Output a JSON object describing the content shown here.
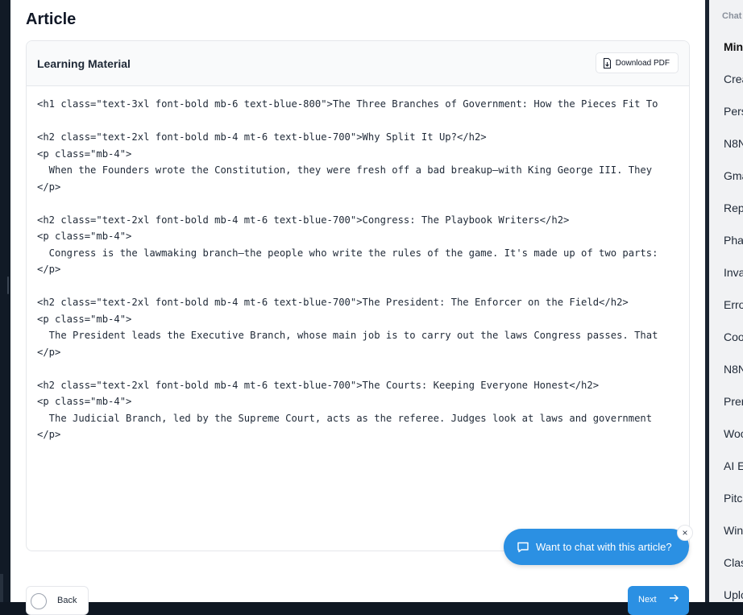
{
  "page": {
    "title": "Article"
  },
  "card": {
    "title": "Learning Material",
    "download_label": "Download PDF",
    "code_lines": [
      "<h1 class=\"text-3xl font-bold mb-6 text-blue-800\">The Three Branches of Government: How the Pieces Fit To",
      "",
      "<h2 class=\"text-2xl font-bold mb-4 mt-6 text-blue-700\">Why Split It Up?</h2>",
      "<p class=\"mb-4\">",
      "  When the Founders wrote the Constitution, they were fresh off a bad breakup—with King George III. They",
      "</p>",
      "",
      "<h2 class=\"text-2xl font-bold mb-4 mt-6 text-blue-700\">Congress: The Playbook Writers</h2>",
      "<p class=\"mb-4\">",
      "  Congress is the lawmaking branch—the people who write the rules of the game. It's made up of two parts:",
      "</p>",
      "",
      "<h2 class=\"text-2xl font-bold mb-4 mt-6 text-blue-700\">The President: The Enforcer on the Field</h2>",
      "<p class=\"mb-4\">",
      "  The President leads the Executive Branch, whose main job is to carry out the laws Congress passes. That",
      "</p>",
      "",
      "<h2 class=\"text-2xl font-bold mb-4 mt-6 text-blue-700\">The Courts: Keeping Everyone Honest</h2>",
      "<p class=\"mb-4\">",
      "  The Judicial Branch, led by the Supreme Court, acts as the referee. Judges look at laws and government",
      "</p>"
    ]
  },
  "chat_cta": {
    "label": "Want to chat with this article?",
    "close": "×"
  },
  "footer": {
    "back_label": "Back",
    "next_label": "Next"
  },
  "sidebar": {
    "heading": "Chat",
    "items": [
      {
        "label": "Min",
        "active": true
      },
      {
        "label": "Crea"
      },
      {
        "label": "Pers"
      },
      {
        "label": "N8N"
      },
      {
        "label": "Gma"
      },
      {
        "label": "Rep"
      },
      {
        "label": "Pha"
      },
      {
        "label": "Inva"
      },
      {
        "label": "Erro"
      },
      {
        "label": "Coo"
      },
      {
        "label": "N8N"
      },
      {
        "label": "Pren"
      },
      {
        "label": "Woo"
      },
      {
        "label": "AI E"
      },
      {
        "label": "Pitc"
      },
      {
        "label": "Win"
      },
      {
        "label": "Clas"
      },
      {
        "label": "Uplo"
      }
    ]
  },
  "colors": {
    "accent": "#2b90e3",
    "text": "#1f2937",
    "panel_bg": "#f1f2f4"
  }
}
